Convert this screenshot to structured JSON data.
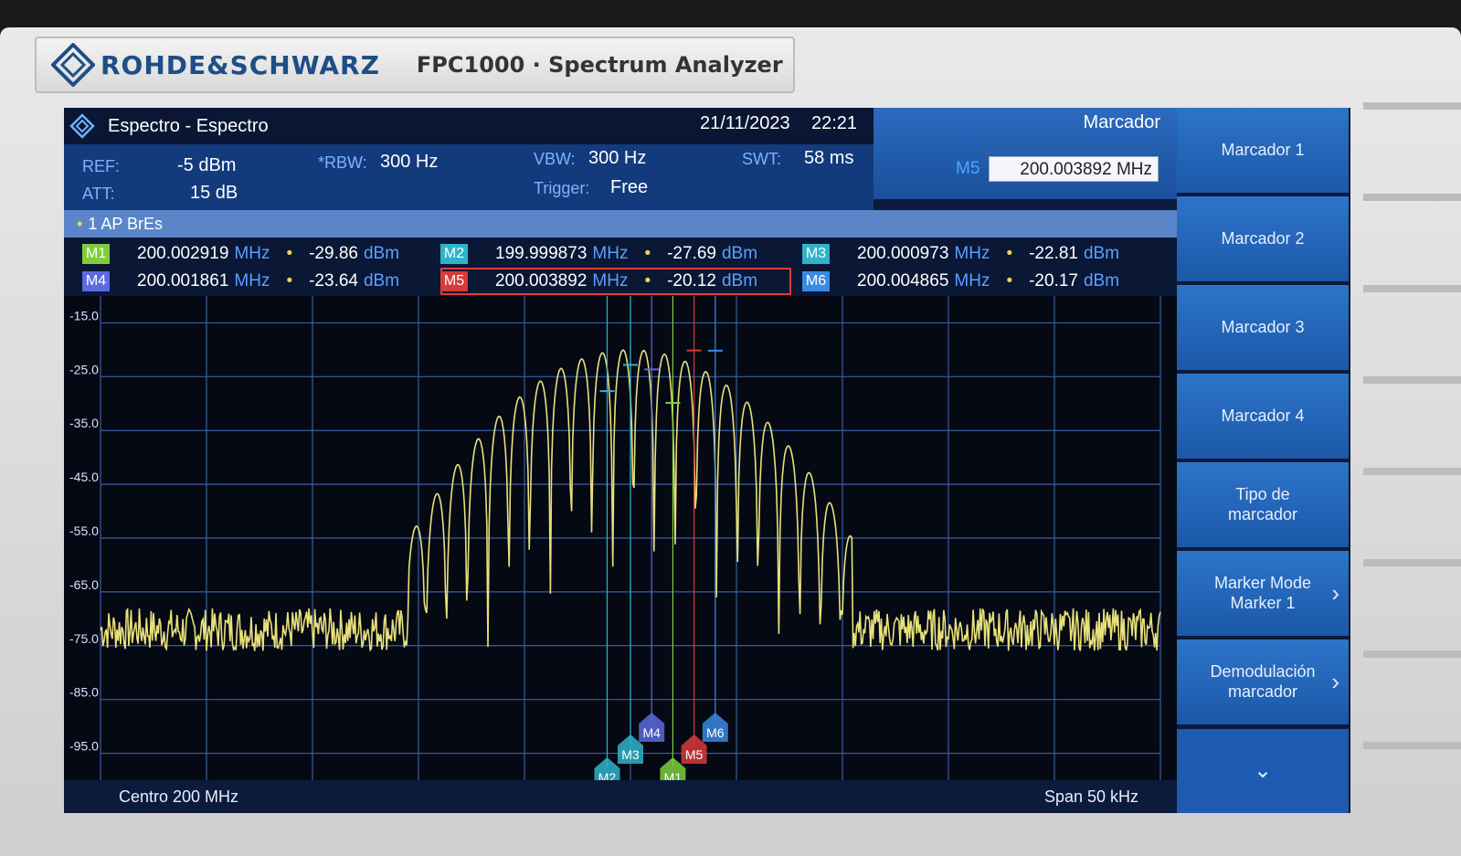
{
  "device": {
    "brand": "ROHDE&SCHWARZ",
    "model": "FPC1000 · Spectrum Analyzer"
  },
  "header": {
    "title": "Espectro - Espectro",
    "date": "21/11/2023",
    "time": "22:21",
    "panel_title": "Marcador"
  },
  "settings": {
    "ref_label": "REF:",
    "ref_value": "-5 dBm",
    "att_label": "ATT:",
    "att_value": "15 dB",
    "rbw_label": "*RBW:",
    "rbw_value": "300 Hz",
    "vbw_label": "VBW:",
    "vbw_value": "300 Hz",
    "trigger_label": "Trigger:",
    "trigger_value": "Free",
    "swt_label": "SWT:",
    "swt_value": "58 ms"
  },
  "marker_entry": {
    "label": "M5",
    "value": "200.003892 MHz"
  },
  "trace": {
    "label": "1 AP BrEs"
  },
  "markers": [
    {
      "id": "M1",
      "freq": "200.002919",
      "freq_unit": "MHz",
      "level": "-29.86",
      "level_unit": "dBm",
      "color": "#7ccf3a"
    },
    {
      "id": "M2",
      "freq": "199.999873",
      "freq_unit": "MHz",
      "level": "-27.69",
      "level_unit": "dBm",
      "color": "#2fb3c9"
    },
    {
      "id": "M3",
      "freq": "200.000973",
      "freq_unit": "MHz",
      "level": "-22.81",
      "level_unit": "dBm",
      "color": "#2fb3c9"
    },
    {
      "id": "M4",
      "freq": "200.001861",
      "freq_unit": "MHz",
      "level": "-23.64",
      "level_unit": "dBm",
      "color": "#5a6be0"
    },
    {
      "id": "M5",
      "freq": "200.003892",
      "freq_unit": "MHz",
      "level": "-20.12",
      "level_unit": "dBm",
      "color": "#d83a3a"
    },
    {
      "id": "M6",
      "freq": "200.004865",
      "freq_unit": "MHz",
      "level": "-20.17",
      "level_unit": "dBm",
      "color": "#3a8ae0"
    }
  ],
  "plot": {
    "y_ticks": [
      "-15.0",
      "-25.0",
      "-35.0",
      "-45.0",
      "-55.0",
      "-65.0",
      "-75.0",
      "-85.0",
      "-95.0"
    ],
    "center_label": "Centro 200 MHz",
    "span_label": "Span 50 kHz",
    "trace_color": "#e8e07a"
  },
  "softkeys": [
    {
      "label": "Marcador 1",
      "arrow": false
    },
    {
      "label": "Marcador 2",
      "arrow": false
    },
    {
      "label": "Marcador 3",
      "arrow": false
    },
    {
      "label": "Marcador 4",
      "arrow": false
    },
    {
      "label": "Tipo de marcador",
      "arrow": false
    },
    {
      "label": "Marker Mode Marker 1",
      "arrow": true
    },
    {
      "label": "Demodulación marcador",
      "arrow": true
    }
  ],
  "more_icon": "chevron-down-icon",
  "chart_data": {
    "type": "line",
    "xlabel": "Centro 200 MHz",
    "span": "Span 50 kHz",
    "x_range_khz": [
      -25,
      25
    ],
    "ylim": [
      -100,
      -10
    ],
    "y_ticks": [
      -15,
      -25,
      -35,
      -45,
      -55,
      -65,
      -75,
      -85,
      -95
    ],
    "grid": true,
    "series": [
      {
        "values_dbm_peaks": [
          {
            "x_khz": -6.4,
            "y": -28
          },
          {
            "x_khz": -5.7,
            "y": -22
          },
          {
            "x_khz": -5.0,
            "y": -20
          },
          {
            "x_khz": -4.3,
            "y": -20
          },
          {
            "x_khz": -3.6,
            "y": -28
          },
          {
            "x_khz": -2.9,
            "y": -24
          },
          {
            "x_khz": -2.2,
            "y": -23
          },
          {
            "x_khz": -1.1,
            "y": -27.69
          },
          {
            "x_khz": 0.0,
            "y": -22.81
          },
          {
            "x_khz": 1.0,
            "y": -23.64
          },
          {
            "x_khz": 2.0,
            "y": -29.86
          },
          {
            "x_khz": 3.0,
            "y": -20.12
          },
          {
            "x_khz": 4.0,
            "y": -20.17
          },
          {
            "x_khz": 5.0,
            "y": -23
          },
          {
            "x_khz": 6.0,
            "y": -30
          },
          {
            "x_khz": 7.0,
            "y": -37
          },
          {
            "x_khz": 8.0,
            "y": -47
          },
          {
            "x_khz": 9.0,
            "y": -57
          }
        ]
      }
    ]
  }
}
